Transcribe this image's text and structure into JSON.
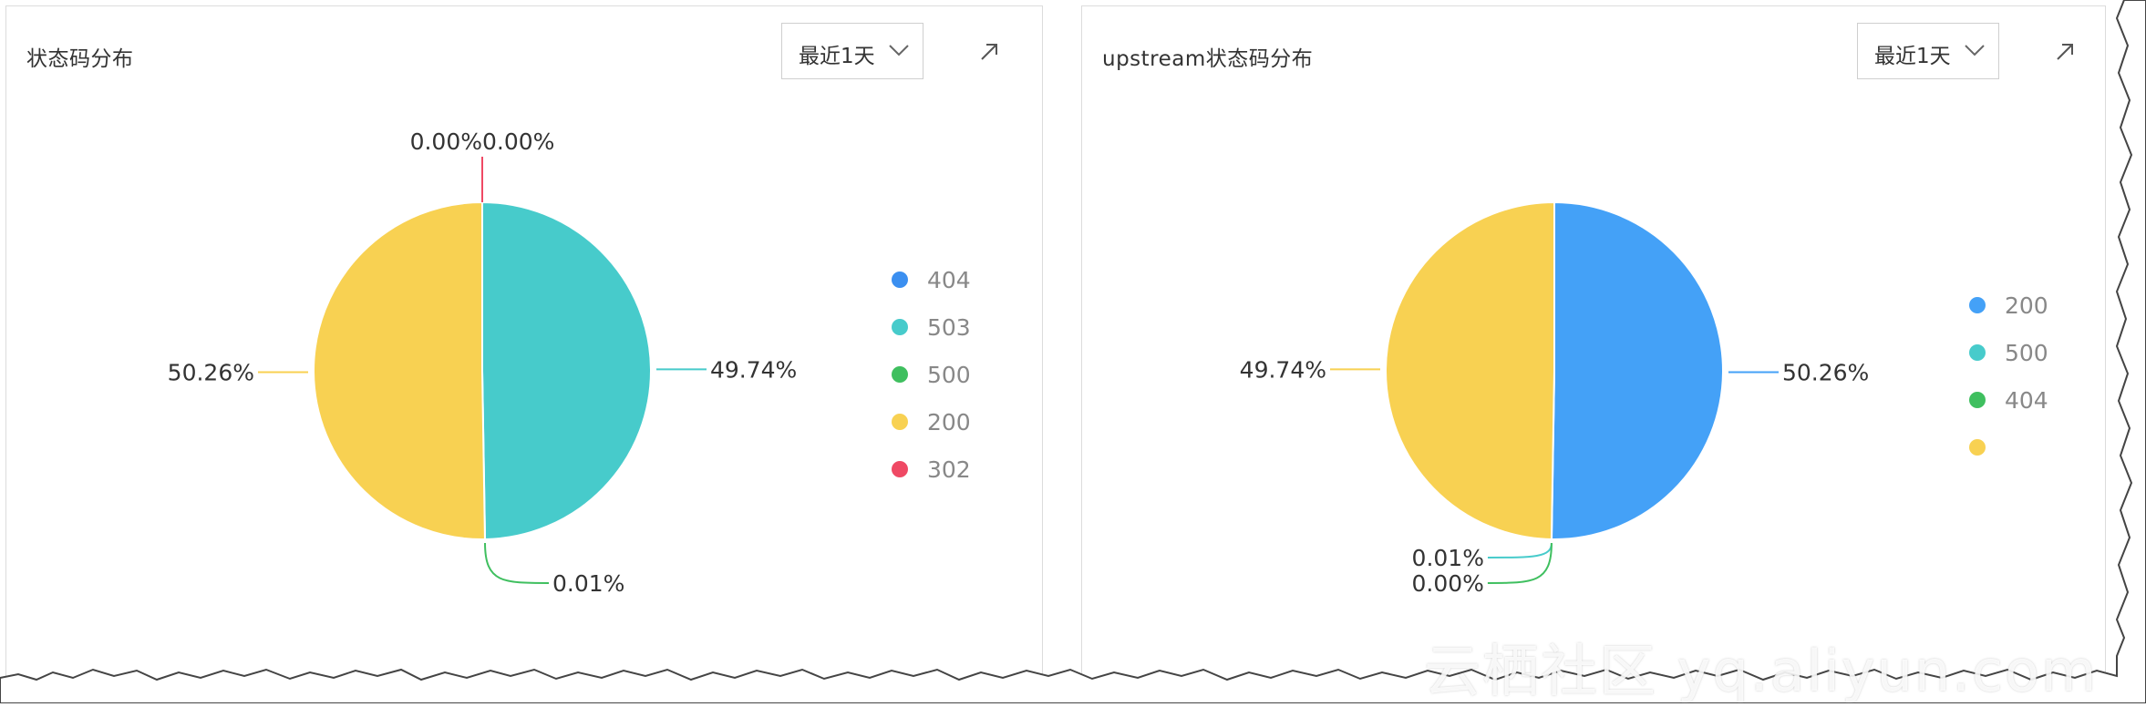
{
  "panels": [
    {
      "title": "状态码分布",
      "time_range": "最近1天",
      "expand_icon": "arrow-up-right-icon"
    },
    {
      "title": "upstream状态码分布",
      "time_range": "最近1天",
      "expand_icon": "arrow-up-right-icon"
    }
  ],
  "watermark": "云栖社区 yq.aliyun.com",
  "chart_data": [
    {
      "type": "pie",
      "title": "状态码分布",
      "legend_position": "right",
      "slices": [
        {
          "label": "404",
          "value": 0.0,
          "display": "0.00%",
          "color": "#3b8ff0"
        },
        {
          "label": "503",
          "value": 49.74,
          "display": "49.74%",
          "color": "#47cbcb"
        },
        {
          "label": "500",
          "value": 0.01,
          "display": "0.01%",
          "color": "#3fbf5f"
        },
        {
          "label": "200",
          "value": 50.26,
          "display": "50.26%",
          "color": "#f8d152"
        },
        {
          "label": "302",
          "value": 0.0,
          "display": "0.00%",
          "color": "#ef4964"
        }
      ]
    },
    {
      "type": "pie",
      "title": "upstream状态码分布",
      "legend_position": "right",
      "slices": [
        {
          "label": "200",
          "value": 50.26,
          "display": "50.26%",
          "color": "#44a1f7"
        },
        {
          "label": "500",
          "value": 0.01,
          "display": "0.01%",
          "color": "#47cbcb"
        },
        {
          "label": "404",
          "value": 0.0,
          "display": "0.00%",
          "color": "#3fbf5f"
        },
        {
          "label": "",
          "value": 49.74,
          "display": "49.74%",
          "color": "#f8d152"
        }
      ]
    }
  ]
}
